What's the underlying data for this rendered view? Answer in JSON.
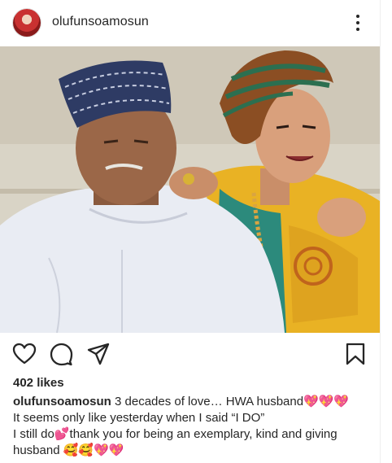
{
  "header": {
    "username": "olufunsoamosun",
    "avatar_icon": "profile-avatar",
    "more_icon": "three-dots-vertical-icon"
  },
  "actions": {
    "like_icon": "heart-outline-icon",
    "comment_icon": "comment-bubble-icon",
    "share_icon": "paper-plane-icon",
    "save_icon": "bookmark-outline-icon"
  },
  "post": {
    "likes": "402 likes",
    "caption_user": "olufunsoamosun",
    "caption_line1": " 3 decades of love… HWA husband💖💖💖",
    "caption_line2": "It seems only like yesterday when I said “I DO”",
    "caption_line3": "I still do💕thank you for being an exemplary, kind and giving",
    "caption_line4": "husband 🥰🥰💖💖"
  },
  "colors": {
    "text": "#262626",
    "background": "#ffffff",
    "agbada_white": "#e9ecf3",
    "gele_yellow": "#e9b224",
    "blouse_teal": "#2c8a7c",
    "cap_navy": "#2e3b64"
  }
}
